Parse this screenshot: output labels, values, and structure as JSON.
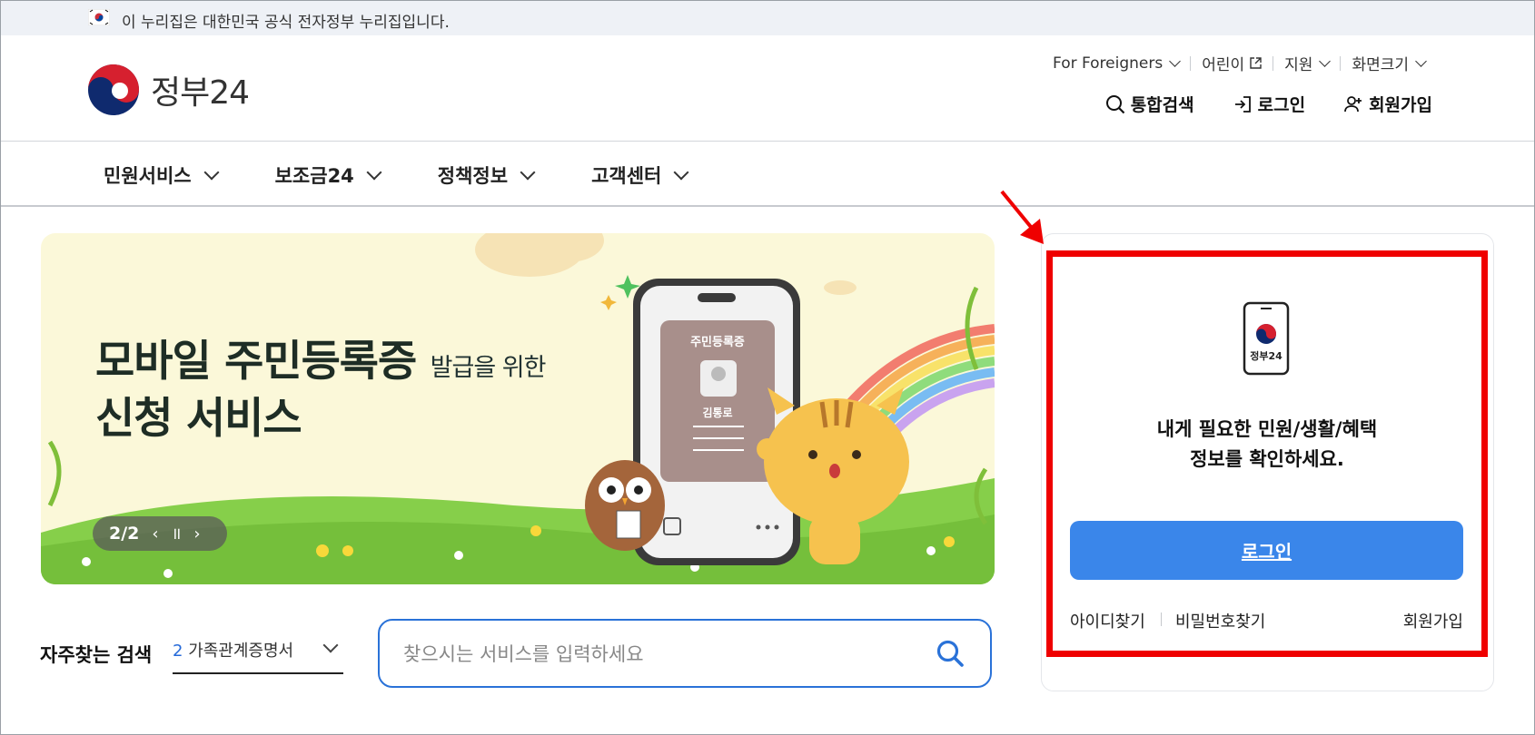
{
  "gov_banner": {
    "text": "이 누리집은 대한민국 공식 전자정부 누리집입니다."
  },
  "logo": {
    "name": "정부24"
  },
  "util_menu": [
    {
      "label": "For Foreigners"
    },
    {
      "label": "어린이"
    },
    {
      "label": "지원"
    },
    {
      "label": "화면크기"
    }
  ],
  "actions": {
    "search": "통합검색",
    "login": "로그인",
    "signup": "회원가입"
  },
  "gnb": [
    "민원서비스",
    "보조금24",
    "정책정보",
    "고객센터"
  ],
  "hero": {
    "title_main": "모바일 주민등록증",
    "title_small": "발급을 위한",
    "title_line2": "신청 서비스",
    "card_title": "주민등록증",
    "card_name": "김통로",
    "pager": {
      "count": "2/2",
      "prev": "‹",
      "pause": "॥",
      "next": "›"
    }
  },
  "frequent_search": {
    "label": "자주찾는 검색",
    "rank": "2",
    "item": "가족관계증명서",
    "placeholder": "찾으시는 서비스를 입력하세요"
  },
  "login_panel": {
    "icon_text": "정부24",
    "msg_line1": "내게 필요한 민원/생활/혜택",
    "msg_line2": "정보를 확인하세요.",
    "button": "로그인",
    "find_id": "아이디찾기",
    "find_pw": "비밀번호찾기",
    "signup": "회원가입"
  },
  "colors": {
    "accent": "#3a86ea",
    "highlight": "#ef0000",
    "search_border": "#2a72d8"
  }
}
